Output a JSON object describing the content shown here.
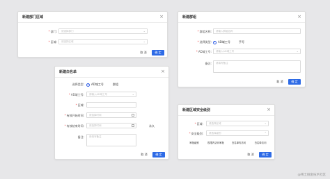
{
  "dialog_dept": {
    "title": "新建部门区域",
    "dept_label": "部门:",
    "dept_placeholder": "请选择部门",
    "region_label": "区域:",
    "region_placeholder": "请选择区域",
    "cancel": "取 消",
    "confirm": "确 定"
  },
  "dialog_group": {
    "title": "新建群组",
    "name_label": "群组名称:",
    "name_placeholder": "请输入群组名称",
    "type_label": "选择类型:",
    "type_options": [
      "AD域工号",
      "手写"
    ],
    "ad_label": "AD域工号:",
    "ad_placeholder": "请输入AD域工号",
    "note_label": "备注:",
    "note_placeholder": "请填写备注",
    "cancel": "取 消",
    "confirm": "确 定"
  },
  "dialog_whitelist": {
    "title": "新建白名单",
    "type_label": "选择类型:",
    "type_options": [
      "AD域工号",
      "群组"
    ],
    "ad_label": "AD域工号:",
    "ad_placeholder": "请输入AD域工号",
    "region_label": "区域:",
    "start_label": "有效开始时间:",
    "start_placeholder": "请选择时间",
    "end_label": "有效结束时间:",
    "end_placeholder": "请选择时间",
    "permanent": "永久",
    "note_label": "备注:",
    "note_placeholder": "请填写备注",
    "cancel": "取 消",
    "confirm": "确 定"
  },
  "dialog_security": {
    "title": "新建区域安全级别",
    "region_label": "区域:",
    "region_placeholder": "请选择区域",
    "level_label": "安全级别:",
    "level_placeholder": "请选择级别",
    "levels": [
      "审批级别",
      "权限内访问审批",
      "白名单内访问",
      "白名单访问"
    ],
    "cancel": "取 消",
    "confirm": "确 定"
  },
  "watermark": "@稀土掘金技术社区",
  "colors": {
    "primary": "#2e6be6",
    "required": "#ee3b3b",
    "background": "#e7e7e9"
  }
}
